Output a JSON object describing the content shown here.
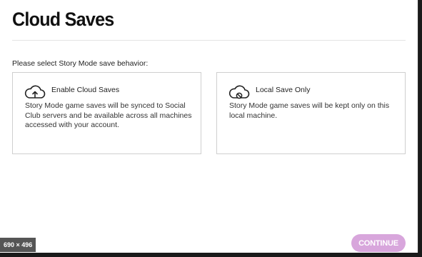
{
  "header": {
    "title": "Cloud Saves"
  },
  "prompt": "Please select Story Mode save behavior:",
  "options": [
    {
      "title": "Enable Cloud Saves",
      "description": "Story Mode game saves will be synced to Social Club servers and be available across all machines accessed with your account.",
      "icon": "cloud-upload-icon"
    },
    {
      "title": "Local Save Only",
      "description": "Story Mode game saves will be kept only on this local machine.",
      "icon": "cloud-disabled-icon"
    }
  ],
  "footer": {
    "continue_label": "CONTINUE"
  },
  "overlay": {
    "image_size": "690 × 496"
  },
  "colors": {
    "accent": "#d8a6dc",
    "text": "#222222",
    "border": "#cfcfcf"
  }
}
